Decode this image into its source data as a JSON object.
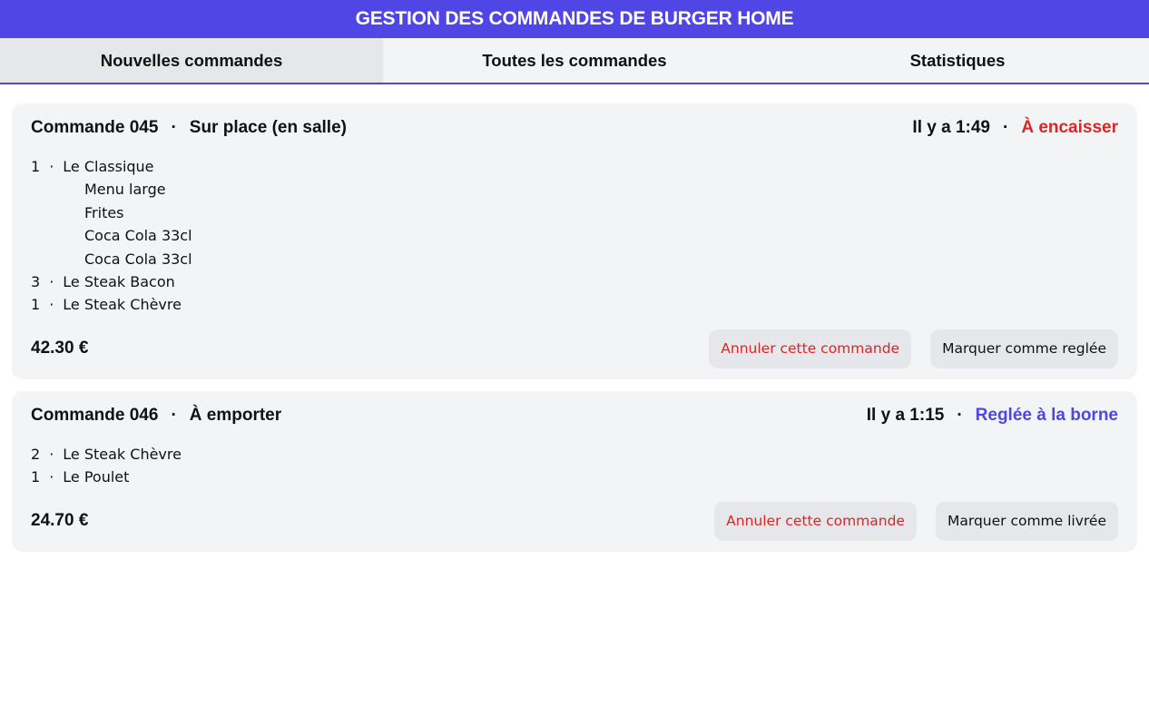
{
  "header": {
    "title": "GESTION DES COMMANDES DE BURGER HOME"
  },
  "tabs": [
    {
      "label": "Nouvelles commandes",
      "active": true
    },
    {
      "label": "Toutes les commandes",
      "active": false
    },
    {
      "label": "Statistiques",
      "active": false
    }
  ],
  "separator": "·",
  "orders": [
    {
      "title": "Commande 045",
      "mode": "Sur place (en salle)",
      "elapsed": "Il y a 1:49",
      "status": "À encaisser",
      "status_color": "#dc2626",
      "items": [
        {
          "qty": "1",
          "name": "Le Classique",
          "subitems": [
            "Menu large",
            "Frites",
            "Coca Cola 33cl",
            "Coca Cola 33cl"
          ]
        },
        {
          "qty": "3",
          "name": "Le Steak Bacon",
          "subitems": []
        },
        {
          "qty": "1",
          "name": "Le Steak Chèvre",
          "subitems": []
        }
      ],
      "total": "42.30 €",
      "cancel_label": "Annuler cette commande",
      "action_label": "Marquer comme reglée"
    },
    {
      "title": "Commande 046",
      "mode": "À emporter",
      "elapsed": "Il y a 1:15",
      "status": "Reglée à la borne",
      "status_color": "#4f46e5",
      "items": [
        {
          "qty": "2",
          "name": "Le Steak Chèvre",
          "subitems": []
        },
        {
          "qty": "1",
          "name": "Le Poulet",
          "subitems": []
        }
      ],
      "total": "24.70 €",
      "cancel_label": "Annuler cette commande",
      "action_label": "Marquer comme livrée"
    }
  ],
  "colors": {
    "accent": "#4f46e5",
    "danger": "#dc2626",
    "card_bg": "#f3f4f6",
    "button_bg": "#e5e7eb"
  }
}
